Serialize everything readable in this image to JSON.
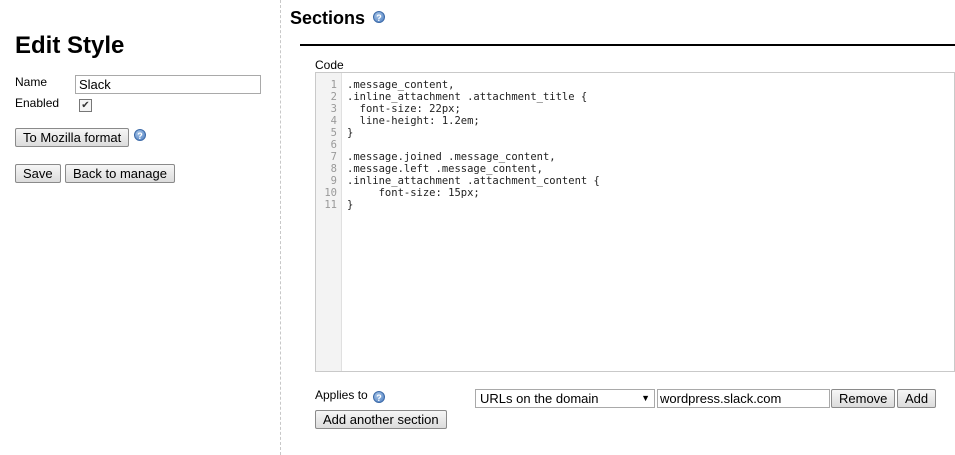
{
  "editor": {
    "title": "Edit Style",
    "name_label": "Name",
    "name_value": "Slack",
    "enabled_label": "Enabled",
    "enabled_checked": true,
    "to_mozilla_label": "To Mozilla format",
    "save_label": "Save",
    "back_label": "Back to manage"
  },
  "sections": {
    "title": "Sections",
    "code_label": "Code",
    "line_numbers": [
      "1",
      "2",
      "3",
      "4",
      "5",
      "6",
      "7",
      "8",
      "9",
      "10",
      "11"
    ],
    "code_lines": [
      ".message_content,",
      ".inline_attachment .attachment_title {",
      "  font-size: 22px;",
      "  line-height: 1.2em;",
      "}",
      "",
      ".message.joined .message_content,",
      ".message.left .message_content,",
      ".inline_attachment .attachment_content {",
      "     font-size: 15px;",
      "}"
    ],
    "applies_label": "Applies to",
    "applies_select": "URLs on the domain",
    "applies_value": "wordpress.slack.com",
    "remove_label": "Remove",
    "add_label": "Add",
    "add_section_label": "Add another section"
  },
  "help_glyph": "?",
  "checkmark": "✔",
  "caret": "▼"
}
